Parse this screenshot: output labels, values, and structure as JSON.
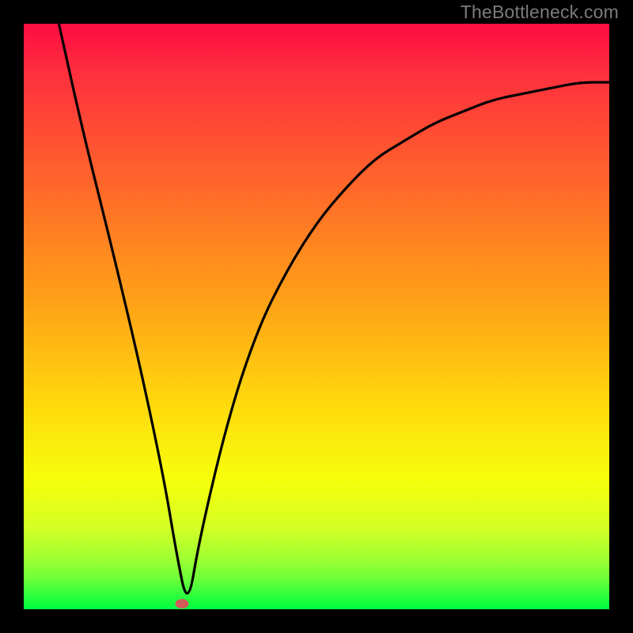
{
  "watermark": "TheBottleneck.com",
  "colors": {
    "background": "#000000",
    "gradient_top": "#fd0c43",
    "gradient_mid": "#ffd60d",
    "gradient_bottom": "#00ff3f",
    "curve": "#000000",
    "marker": "#d25a5a"
  },
  "chart_data": {
    "type": "line",
    "title": "",
    "xlabel": "",
    "ylabel": "",
    "xlim": [
      0,
      100
    ],
    "ylim": [
      0,
      100
    ],
    "series": [
      {
        "name": "bottleneck-curve",
        "x": [
          6,
          10,
          15,
          20,
          24,
          26,
          28,
          30,
          35,
          40,
          45,
          50,
          55,
          60,
          65,
          70,
          75,
          80,
          85,
          90,
          95,
          100
        ],
        "values": [
          100,
          82,
          62,
          41,
          22,
          10,
          0,
          12,
          33,
          48,
          58,
          66,
          72,
          77,
          80,
          83,
          85,
          87,
          88,
          89,
          90,
          90
        ]
      }
    ],
    "marker": {
      "x": 27,
      "y": 1
    },
    "annotations": []
  }
}
